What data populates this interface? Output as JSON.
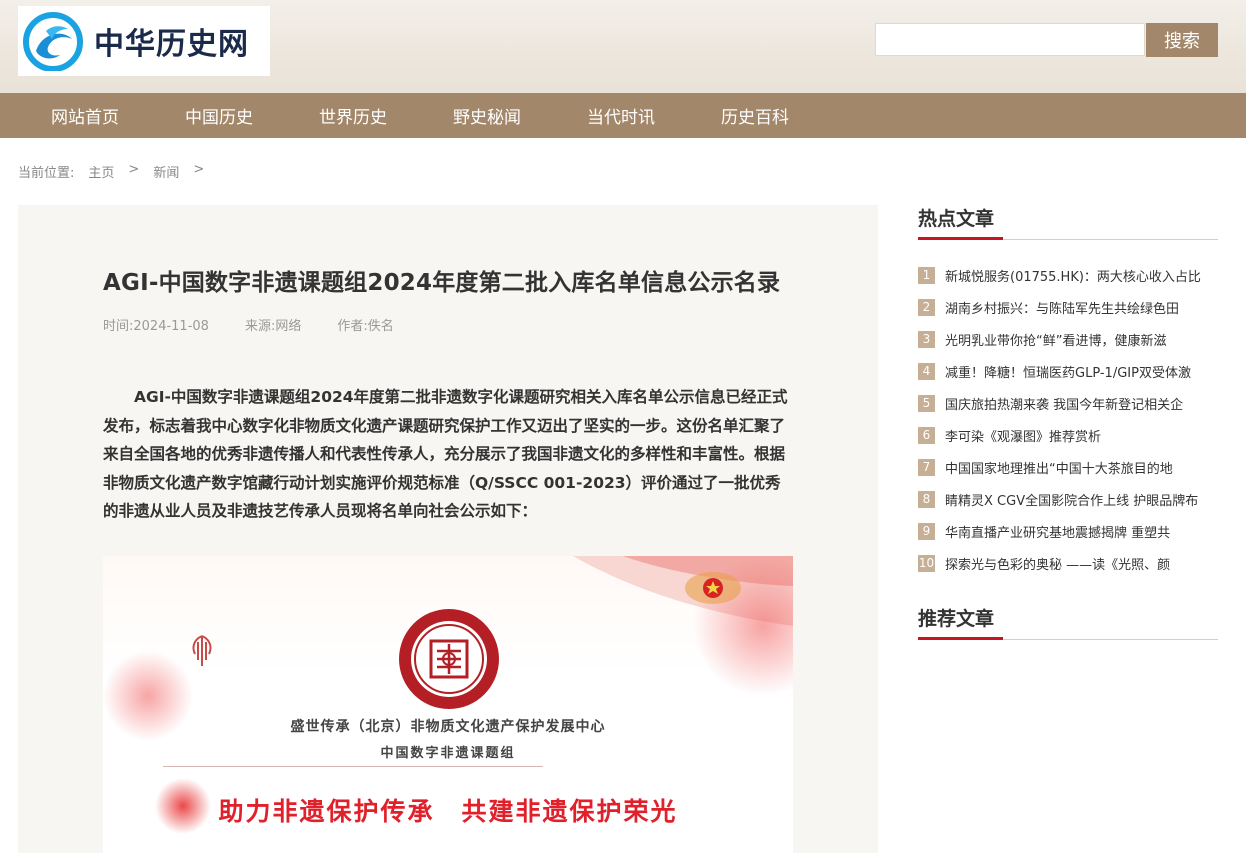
{
  "site": {
    "name": "中华历史网"
  },
  "search": {
    "placeholder": "",
    "button": "搜索"
  },
  "nav": [
    "网站首页",
    "中国历史",
    "世界历史",
    "野史秘闻",
    "当代时讯",
    "历史百科"
  ],
  "breadcrumb": {
    "label": "当前位置:",
    "home": "主页",
    "sep1": ">",
    "section": "新闻",
    "sep2": ">"
  },
  "article": {
    "title": "AGI-中国数字非遗课题组2024年度第二批入库名单信息公示名录",
    "time_label": "时间:",
    "time": "2024-11-08",
    "source_label": "来源:",
    "source": "网络",
    "author_label": "作者:",
    "author": "佚名",
    "body": "AGI-中国数字非遗课题组2024年度第二批非遗数字化课题研究相关入库名单公示信息已经正式发布，标志着我中心数字化非物质文化遗产课题研究保护工作又迈出了坚实的一步。这份名单汇聚了来自全国各地的优秀非遗传播人和代表性传承人，充分展示了我国非遗文化的多样性和丰富性。根据非物质文化遗产数字馆藏行动计划实施评价规范标准（Q/SSCC 001-2023）评价通过了一批优秀的非遗从业人员及非遗技艺传承人员现将名单向社会公示如下：",
    "poster": {
      "org": "盛世传承（北京）非物质文化遗产保护发展中心",
      "group": "中国数字非遗课题组",
      "slogan": "助力非遗保护传承　共建非遗保护荣光"
    }
  },
  "sidebar": {
    "hot_title": "热点文章",
    "hot": [
      "新城悦服务(01755.HK)：两大核心收入占比",
      "湖南乡村振兴：与陈陆军先生共绘绿色田",
      "光明乳业带你抢“鲜”看进博，健康新滋",
      "减重！降糖！恒瑞医药GLP-1/GIP双受体激",
      "国庆旅拍热潮来袭 我国今年新登记相关企",
      "李可染《观瀑图》推荐赏析",
      "中国国家地理推出“中国十大茶旅目的地",
      "睛精灵X CGV全国影院合作上线 护眼品牌布",
      "华南直播产业研究基地震撼揭牌 重塑共",
      "探索光与色彩的奥秘 ——读《光照、颜"
    ],
    "rec_title": "推荐文章"
  }
}
